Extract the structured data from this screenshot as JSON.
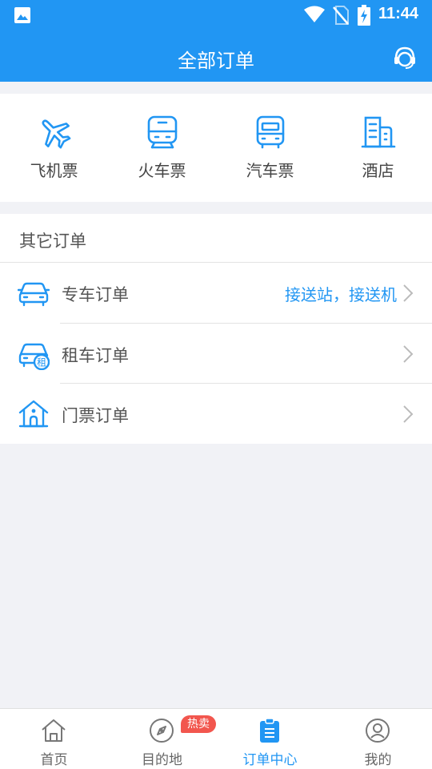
{
  "status_bar": {
    "time": "11:44"
  },
  "header": {
    "title": "全部订单"
  },
  "quick_links": [
    {
      "label": "飞机票",
      "icon": "airplane-icon"
    },
    {
      "label": "火车票",
      "icon": "train-icon"
    },
    {
      "label": "汽车票",
      "icon": "bus-icon"
    },
    {
      "label": "酒店",
      "icon": "hotel-icon"
    }
  ],
  "other_orders": {
    "title": "其它订单",
    "rows": [
      {
        "label": "专车订单",
        "hint": "接送站，接送机",
        "icon": "car-icon"
      },
      {
        "label": "租车订单",
        "hint": "",
        "icon": "rental-car-icon",
        "icon_text": "租"
      },
      {
        "label": "门票订单",
        "hint": "",
        "icon": "ticket-house-icon"
      }
    ]
  },
  "bottom_nav": {
    "items": [
      {
        "label": "首页",
        "icon": "home-icon"
      },
      {
        "label": "目的地",
        "icon": "compass-icon"
      },
      {
        "label": "订单中心",
        "icon": "clipboard-icon"
      },
      {
        "label": "我的",
        "icon": "user-icon"
      }
    ],
    "active_index": 2,
    "badge": "热卖"
  },
  "colors": {
    "primary": "#2196f3",
    "badge": "#f2564e",
    "background": "#f1f2f6"
  }
}
